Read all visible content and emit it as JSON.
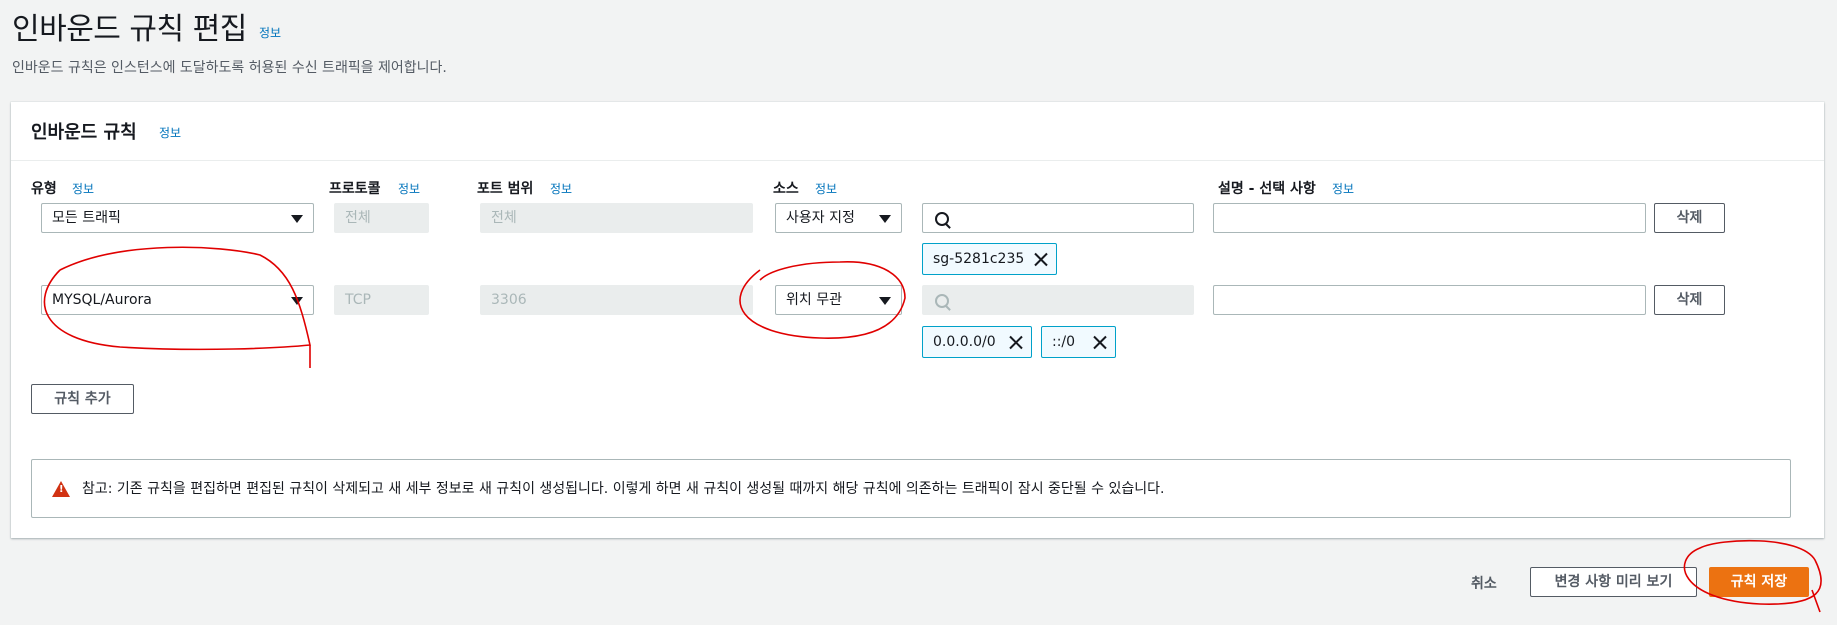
{
  "page": {
    "title": "인바운드 규칙 편집",
    "info": "정보",
    "subtitle": "인바운드 규칙은 인스턴스에 도달하도록 허용된 수신 트래픽을 제어합니다."
  },
  "panel": {
    "title": "인바운드 규칙",
    "info": "정보"
  },
  "columns": {
    "type": "유형",
    "protocol": "프로토콜",
    "port_range": "포트 범위",
    "source": "소스",
    "description": "설명 - 선택 사항",
    "info": "정보"
  },
  "rules": [
    {
      "type": "모든 트래픽",
      "protocol": "전체",
      "port_range": "전체",
      "source": "사용자 지정",
      "tokens": [
        "sg-5281c235"
      ],
      "delete_label": "삭제"
    },
    {
      "type": "MYSQL/Aurora",
      "protocol": "TCP",
      "port_range": "3306",
      "source": "위치 무관",
      "tokens": [
        "0.0.0.0/0",
        "::/0"
      ],
      "delete_label": "삭제"
    }
  ],
  "add_rule_label": "규칙 추가",
  "alert": {
    "text": "참고: 기존 규칙을 편집하면 편집된 규칙이 삭제되고 새 세부 정보로 새 규칙이 생성됩니다. 이렇게 하면 새 규칙이 생성될 때까지 해당 규칙에 의존하는 트래픽이 잠시 중단될 수 있습니다."
  },
  "footer": {
    "cancel": "취소",
    "preview": "변경 사항 미리 보기",
    "save": "규칙 저장"
  },
  "colors": {
    "primary": "#ec7211",
    "link": "#0073bb",
    "token_border": "#00a1c9",
    "warning": "#d13212",
    "annotation": "#e00000"
  }
}
